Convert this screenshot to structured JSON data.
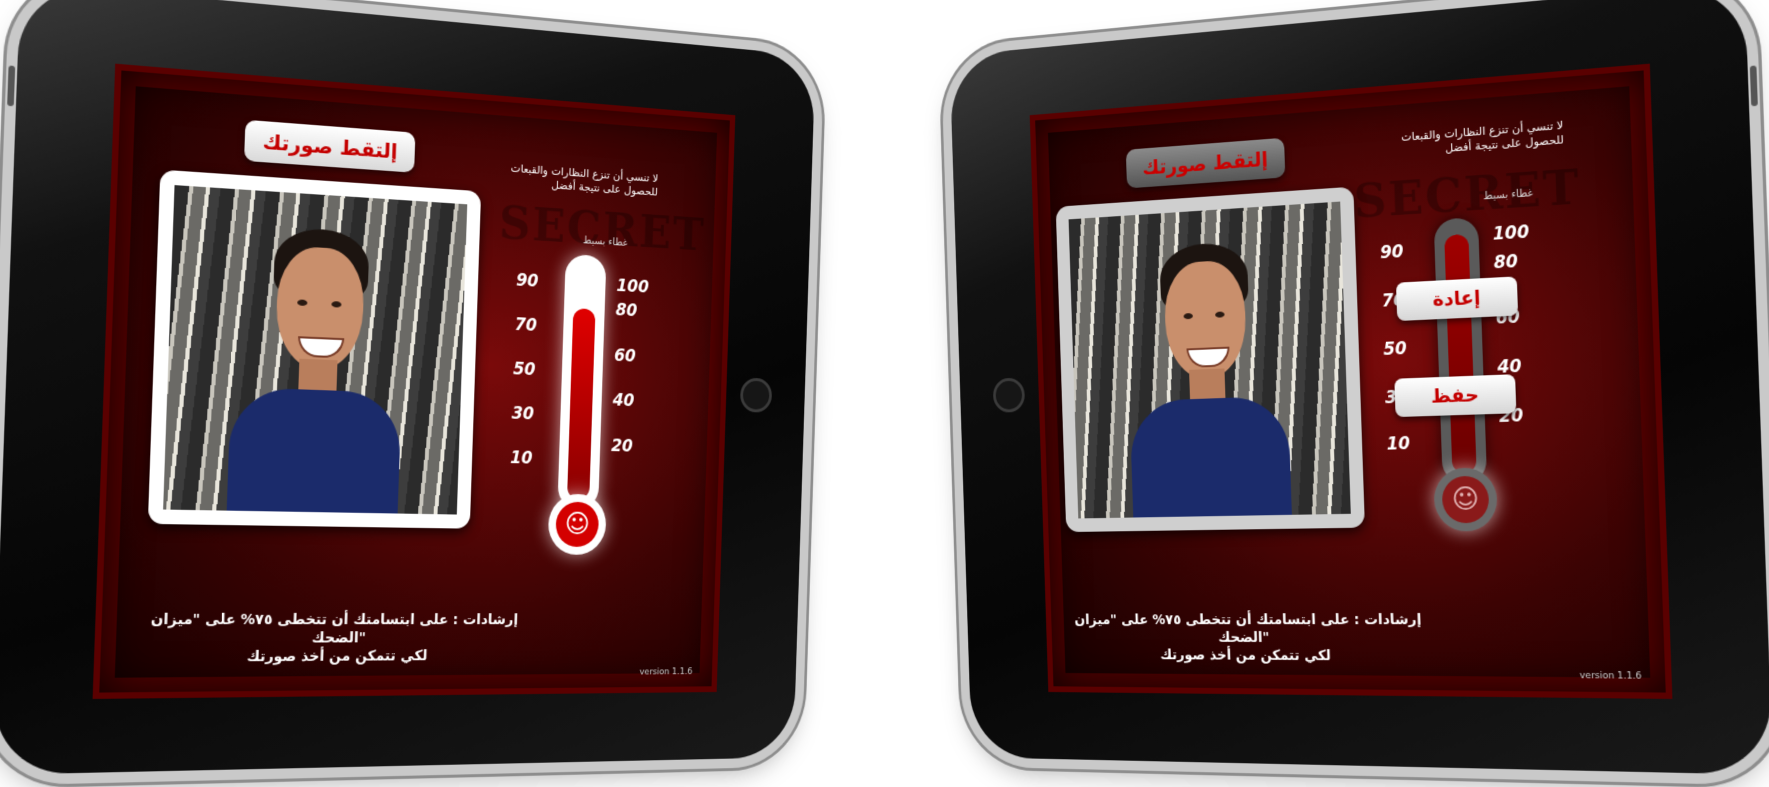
{
  "left_screen": {
    "take_photo_button": "إلتقط صورتك",
    "hint_text": "لا تنسي أن تنزع النظارات والقبعات للحصول على نتيجة أفضل",
    "hint_small": "غطاء بسيط",
    "scale_left": [
      "90",
      "70",
      "50",
      "30",
      "10"
    ],
    "scale_right": [
      "100",
      "80",
      "60",
      "40",
      "20"
    ],
    "smile_level_percent": 75,
    "instruction_line1": "إرشادات : على ابتسامتك أن تتخطى ٧٥% على \"ميزان الضحك\"",
    "instruction_line2": "لكي تتمكن من أخذ صورتك",
    "version": "version 1.1.6",
    "bg_text": "SECRET"
  },
  "right_screen": {
    "take_photo_button": "إلتقط صورتك",
    "hint_text": "لا تنسي أن تنزع النظارات والقبعات للحصول على نتيجة أفضل",
    "hint_small": "غطاء بسيط",
    "scale_left": [
      "90",
      "70",
      "50",
      "30",
      "10"
    ],
    "scale_right": [
      "100",
      "80",
      "60",
      "40",
      "20"
    ],
    "retry_button": "إعادة",
    "save_button": "حفظ",
    "instruction_line1": "إرشادات : على ابتسامتك أن تتخطى ٧٥% على \"ميزان الضحك\"",
    "instruction_line2": "لكي تتمكن من أخذ صورتك",
    "version": "version 1.1.6",
    "bg_text": "SECRET"
  },
  "colors": {
    "accent": "#c40000",
    "screen_bg": "#3c0303",
    "bezel": "#0a0a0a"
  }
}
